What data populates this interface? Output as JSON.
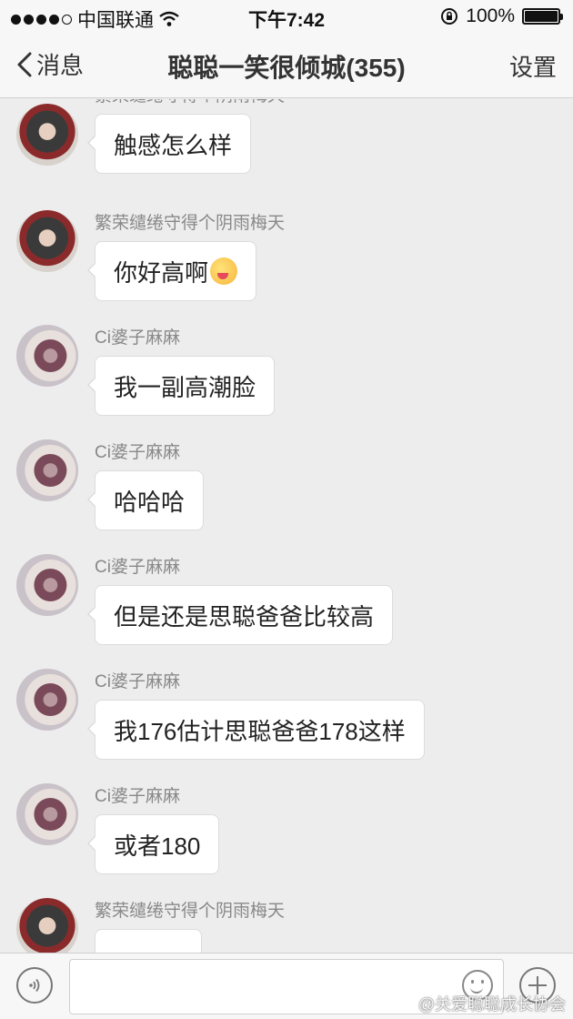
{
  "status_bar": {
    "carrier": "中国联通",
    "time": "下午7:42",
    "battery": "100%",
    "battery_level": 1.0
  },
  "nav": {
    "back_label": "消息",
    "title": "聪聪一笑很倾城(355)",
    "settings_label": "设置"
  },
  "messages": [
    {
      "sender": "繁荣缱绻守得个阴雨梅天",
      "text": "触感怎么样",
      "avatar": "dark"
    },
    {
      "sender": "繁荣缱绻守得个阴雨梅天",
      "text": "你好高啊",
      "avatar": "dark",
      "emoji": "blushing-face"
    },
    {
      "sender": "Ci婆子麻麻",
      "text": "我一副高潮脸",
      "avatar": "light"
    },
    {
      "sender": "Ci婆子麻麻",
      "text": "哈哈哈",
      "avatar": "light"
    },
    {
      "sender": "Ci婆子麻麻",
      "text": "但是还是思聪爸爸比较高",
      "avatar": "light"
    },
    {
      "sender": "Ci婆子麻麻",
      "text": "我176估计思聪爸爸178这样",
      "avatar": "light"
    },
    {
      "sender": "Ci婆子麻麻",
      "text": "或者180",
      "avatar": "light"
    },
    {
      "sender": "繁荣缱绻守得个阴雨梅天",
      "text": "",
      "avatar": "dark"
    }
  ],
  "input_bar": {
    "value": "",
    "watermark": "@关爱聪聪成长协会"
  }
}
